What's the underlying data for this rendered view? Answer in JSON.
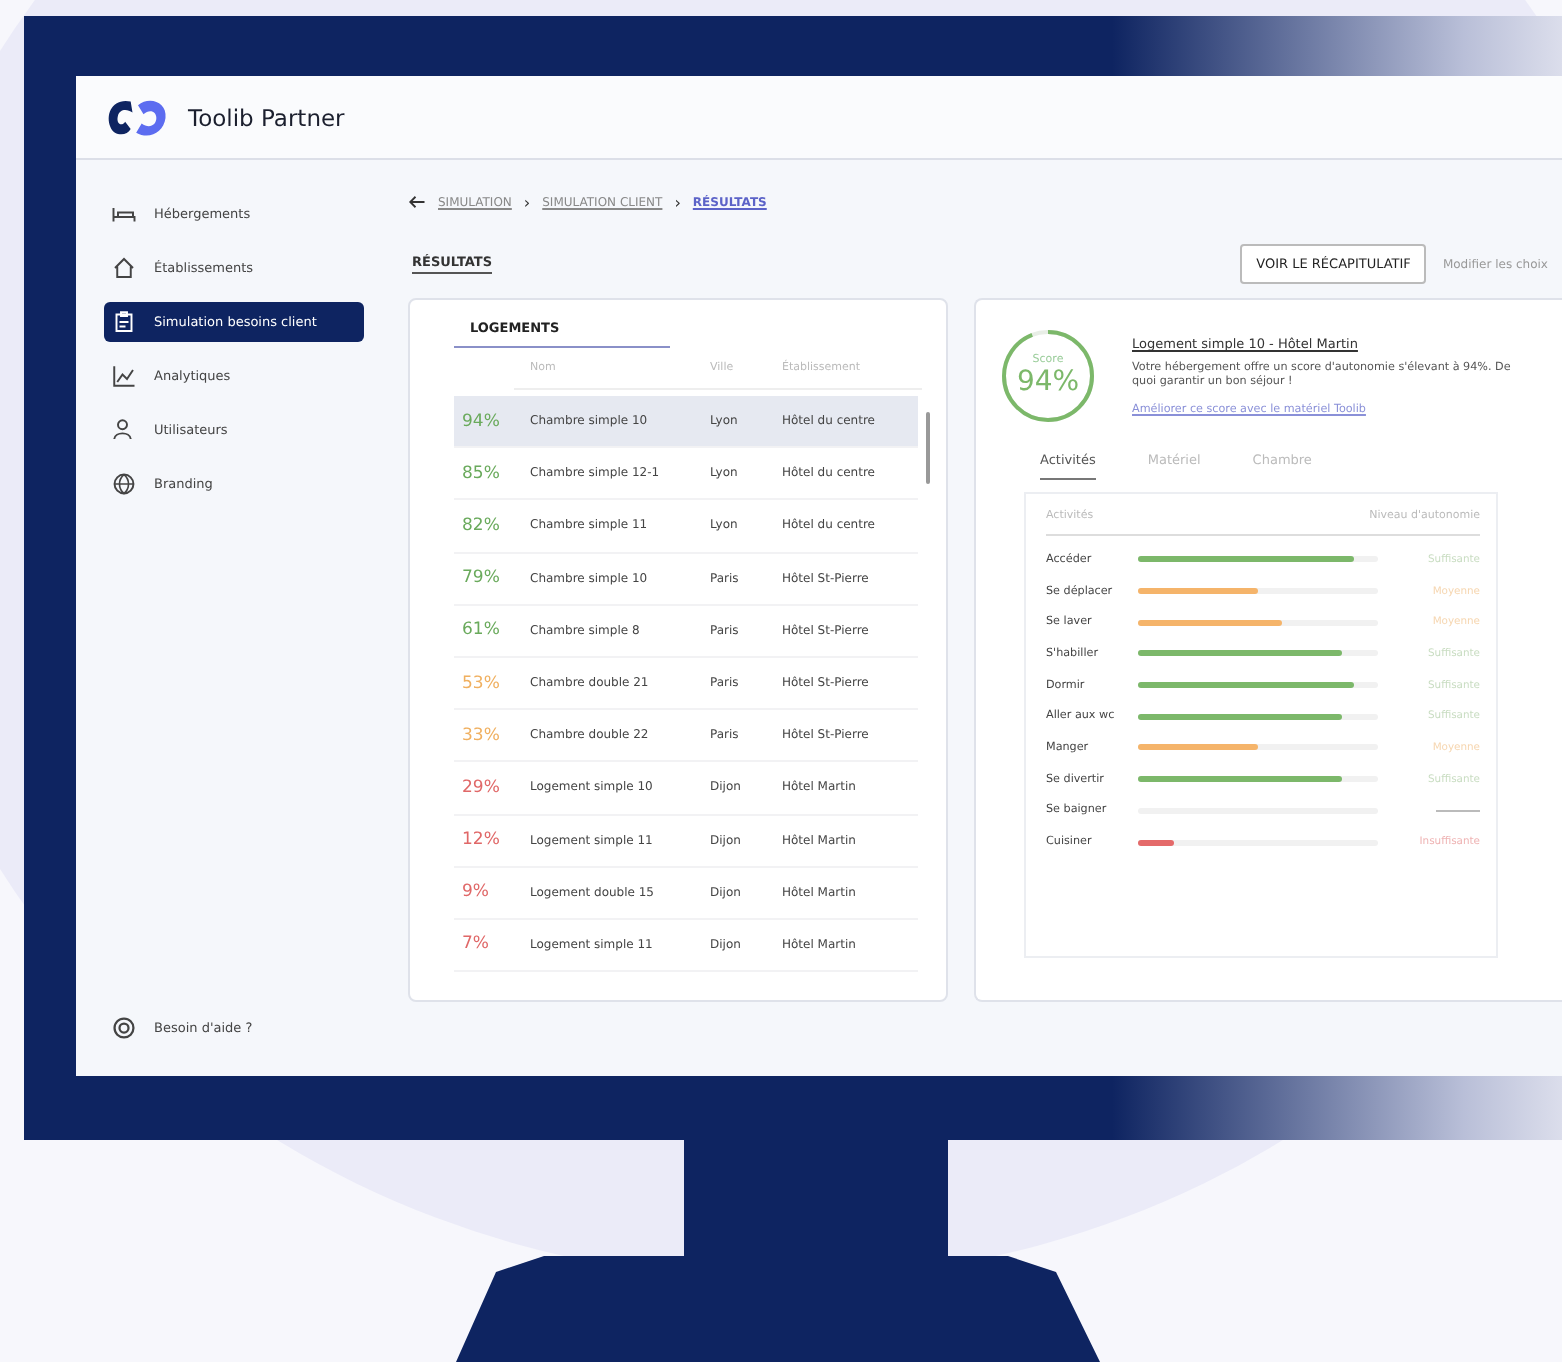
{
  "app": {
    "name": "Toolib Partner"
  },
  "sidebar": {
    "items": [
      {
        "label": "Hébergements",
        "selected": false
      },
      {
        "label": "Établissements",
        "selected": false
      },
      {
        "label": "Simulation besoins client",
        "selected": true
      },
      {
        "label": "Analytiques",
        "selected": false
      },
      {
        "label": "Utilisateurs",
        "selected": false
      },
      {
        "label": "Branding",
        "selected": false
      }
    ],
    "help": "Besoin d'aide ?"
  },
  "breadcrumb": [
    {
      "label": "SIMULATION",
      "current": false
    },
    {
      "label": "SIMULATION CLIENT",
      "current": false
    },
    {
      "label": "RÉSULTATS",
      "current": true
    }
  ],
  "breadcrumb_separator": "›",
  "page_tab": "RÉSULTATS",
  "actions": {
    "primary": "VOIR LE RÉCAPITULATIF",
    "secondary": "Modifier les choix"
  },
  "table": {
    "title": "LOGEMENTS",
    "columns": [
      "Nom",
      "Ville",
      "Établissement"
    ],
    "rows": [
      {
        "score": "94%",
        "color": "#6aaa5c",
        "name": "Chambre simple 10",
        "city": "Lyon",
        "establishment": "Hôtel du centre",
        "selected": true
      },
      {
        "score": "85%",
        "color": "#6aaa5c",
        "name": "Chambre simple 12-1",
        "city": "Lyon",
        "establishment": "Hôtel du centre",
        "selected": false
      },
      {
        "score": "82%",
        "color": "#6aaa5c",
        "name": "Chambre simple 11",
        "city": "Lyon",
        "establishment": "Hôtel du centre",
        "selected": false
      },
      {
        "score": "79%",
        "color": "#6aaa5c",
        "name": "Chambre simple 10",
        "city": "Paris",
        "establishment": "Hôtel St-Pierre",
        "selected": false
      },
      {
        "score": "61%",
        "color": "#6aaa5c",
        "name": "Chambre simple 8",
        "city": "Paris",
        "establishment": "Hôtel St-Pierre",
        "selected": false
      },
      {
        "score": "53%",
        "color": "#f0b060",
        "name": "Chambre double 21",
        "city": "Paris",
        "establishment": "Hôtel St-Pierre",
        "selected": false
      },
      {
        "score": "33%",
        "color": "#f0b060",
        "name": "Chambre double 22",
        "city": "Paris",
        "establishment": "Hôtel St-Pierre",
        "selected": false
      },
      {
        "score": "29%",
        "color": "#e06868",
        "name": "Logement simple 10",
        "city": "Dijon",
        "establishment": "Hôtel Martin",
        "selected": false
      },
      {
        "score": "12%",
        "color": "#e06868",
        "name": "Logement simple 11",
        "city": "Dijon",
        "establishment": "Hôtel Martin",
        "selected": false
      },
      {
        "score": "9%",
        "color": "#e06868",
        "name": "Logement double 15",
        "city": "Dijon",
        "establishment": "Hôtel Martin",
        "selected": false
      },
      {
        "score": "7%",
        "color": "#e06868",
        "name": "Logement simple 11",
        "city": "Dijon",
        "establishment": "Hôtel Martin",
        "selected": false
      }
    ]
  },
  "detail": {
    "score_label": "Score",
    "score": "94%",
    "level": 0.94,
    "title": "Logement simple 10 - Hôtel Martin",
    "description": "Votre hébergement offre un score d'autonomie s'élevant à 94%. De quoi garantir un bon séjour !",
    "link": "Améliorer ce score avec le matériel Toolib",
    "tabs": [
      {
        "label": "Activités",
        "selected": true
      },
      {
        "label": "Matériel",
        "selected": false
      },
      {
        "label": "Chambre",
        "selected": false
      }
    ],
    "columns": [
      "Activités",
      "Niveau d'autonomie"
    ],
    "activities": [
      {
        "name": "Accéder",
        "kind": "good",
        "level": 0.9,
        "status": "Suffisante"
      },
      {
        "name": "Se déplacer",
        "kind": "medium",
        "level": 0.5,
        "status": "Moyenne"
      },
      {
        "name": "Se laver",
        "kind": "medium",
        "level": 0.6,
        "status": "Moyenne"
      },
      {
        "name": "S'habiller",
        "kind": "good",
        "level": 0.85,
        "status": "Suffisante"
      },
      {
        "name": "Dormir",
        "kind": "good",
        "level": 0.9,
        "status": "Suffisante"
      },
      {
        "name": "Aller aux wc",
        "kind": "good",
        "level": 0.85,
        "status": "Suffisante"
      },
      {
        "name": "Manger",
        "kind": "medium",
        "level": 0.5,
        "status": "Moyenne"
      },
      {
        "name": "Se divertir",
        "kind": "good",
        "level": 0.85,
        "status": "Suffisante"
      },
      {
        "name": "Se baigner",
        "kind": "none"
      },
      {
        "name": "Cuisiner",
        "kind": "bad",
        "level": 0.15,
        "status": "Insuffisante"
      }
    ]
  }
}
